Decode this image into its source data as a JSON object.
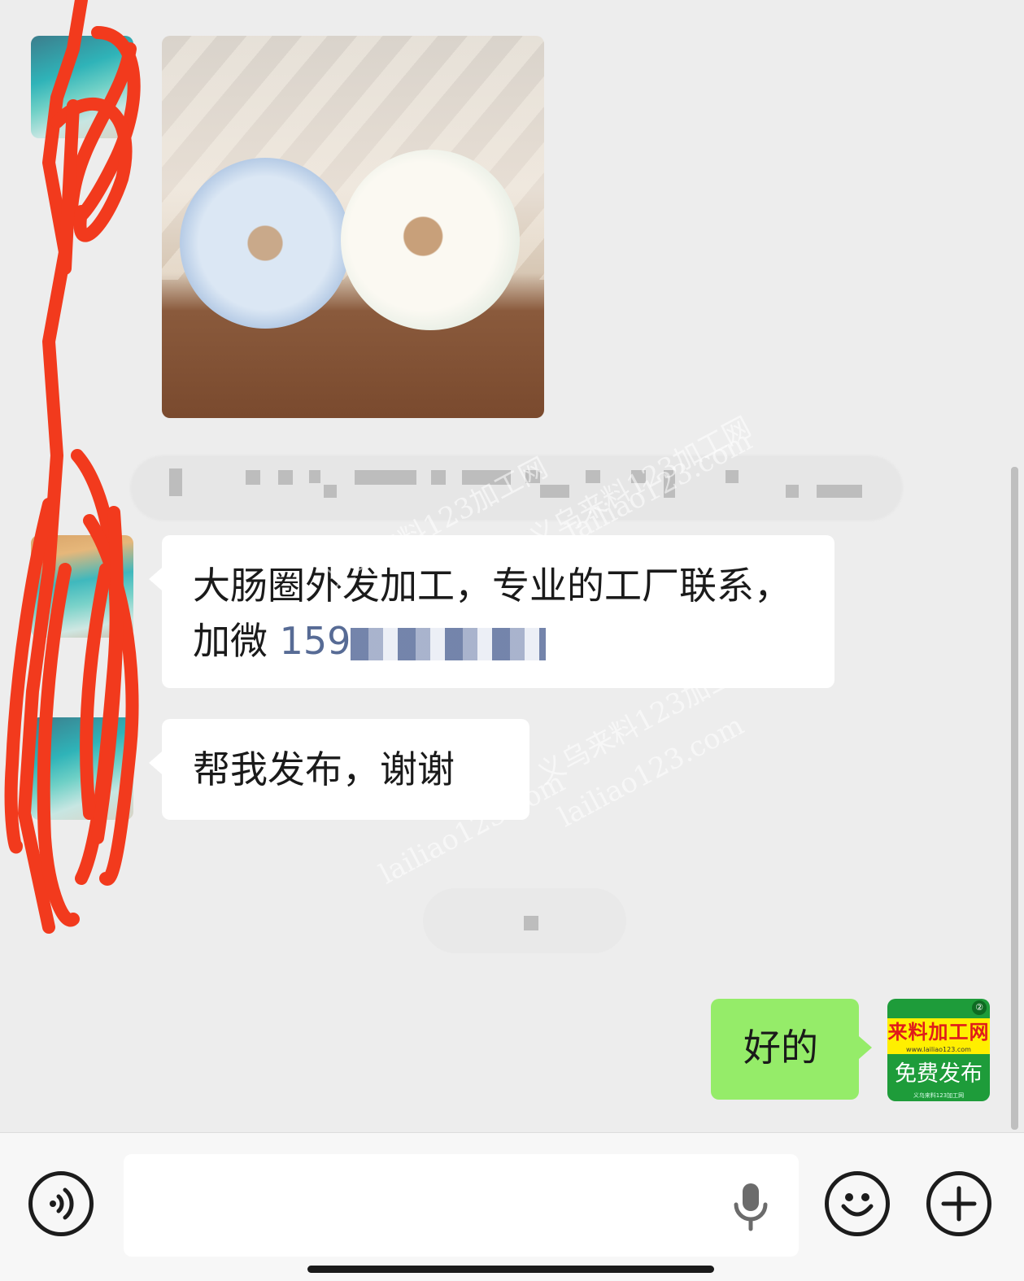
{
  "messages": {
    "m1_text": "大肠圈外发加工，专业的工厂联系，加微",
    "m1_phone": "159",
    "m2_text": "帮我发布，谢谢",
    "reply_text": "好的"
  },
  "my_avatar": {
    "title": "来料加工网",
    "url": "www.lailiao123.com",
    "subtitle": "免费发布",
    "footer": "义乌来料123加工网",
    "badge": "②"
  },
  "watermarks": [
    "义乌来料123加工网",
    "lailiao123.com"
  ],
  "input": {
    "placeholder": ""
  },
  "icons": {
    "voice": "voice-mode-icon",
    "mic": "microphone-icon",
    "emoji": "emoji-icon",
    "plus": "plus-icon"
  }
}
